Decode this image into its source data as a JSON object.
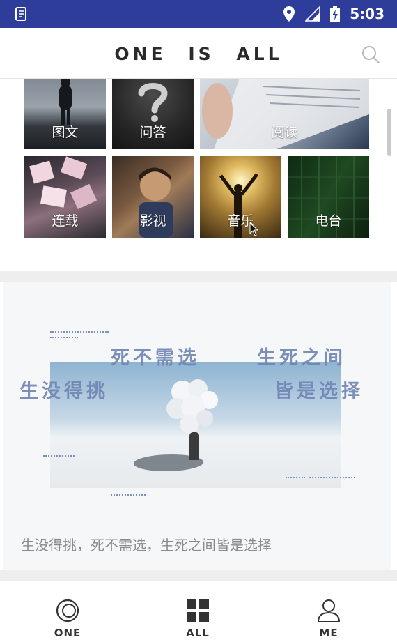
{
  "status_bar": {
    "time": "5:03",
    "icons": [
      "notification-file-icon",
      "location-icon",
      "signal-icon",
      "battery-charging-icon"
    ]
  },
  "app_bar": {
    "title": "ONE   IS   ALL",
    "search_icon": "search-icon"
  },
  "categories": [
    {
      "label": "图文"
    },
    {
      "label": "问答"
    },
    {
      "label": "阅读"
    },
    {
      "label": "连载"
    },
    {
      "label": "影视"
    },
    {
      "label": "音乐"
    },
    {
      "label": "电台"
    }
  ],
  "feature_card": {
    "poem_lines": [
      "死不需选",
      "生死之间",
      "生没得挑",
      "皆是选择"
    ],
    "caption": "生没得挑，死不需选，生死之间皆是选择"
  },
  "bottom_nav": [
    {
      "label": "ONE",
      "icon": "one-circle-icon"
    },
    {
      "label": "ALL",
      "icon": "grid-icon"
    },
    {
      "label": "ME",
      "icon": "person-icon"
    }
  ],
  "colors": {
    "status_bar": "#2d3d99",
    "poem_text": "#6f84b3",
    "caption_text": "#8a8a8a"
  }
}
